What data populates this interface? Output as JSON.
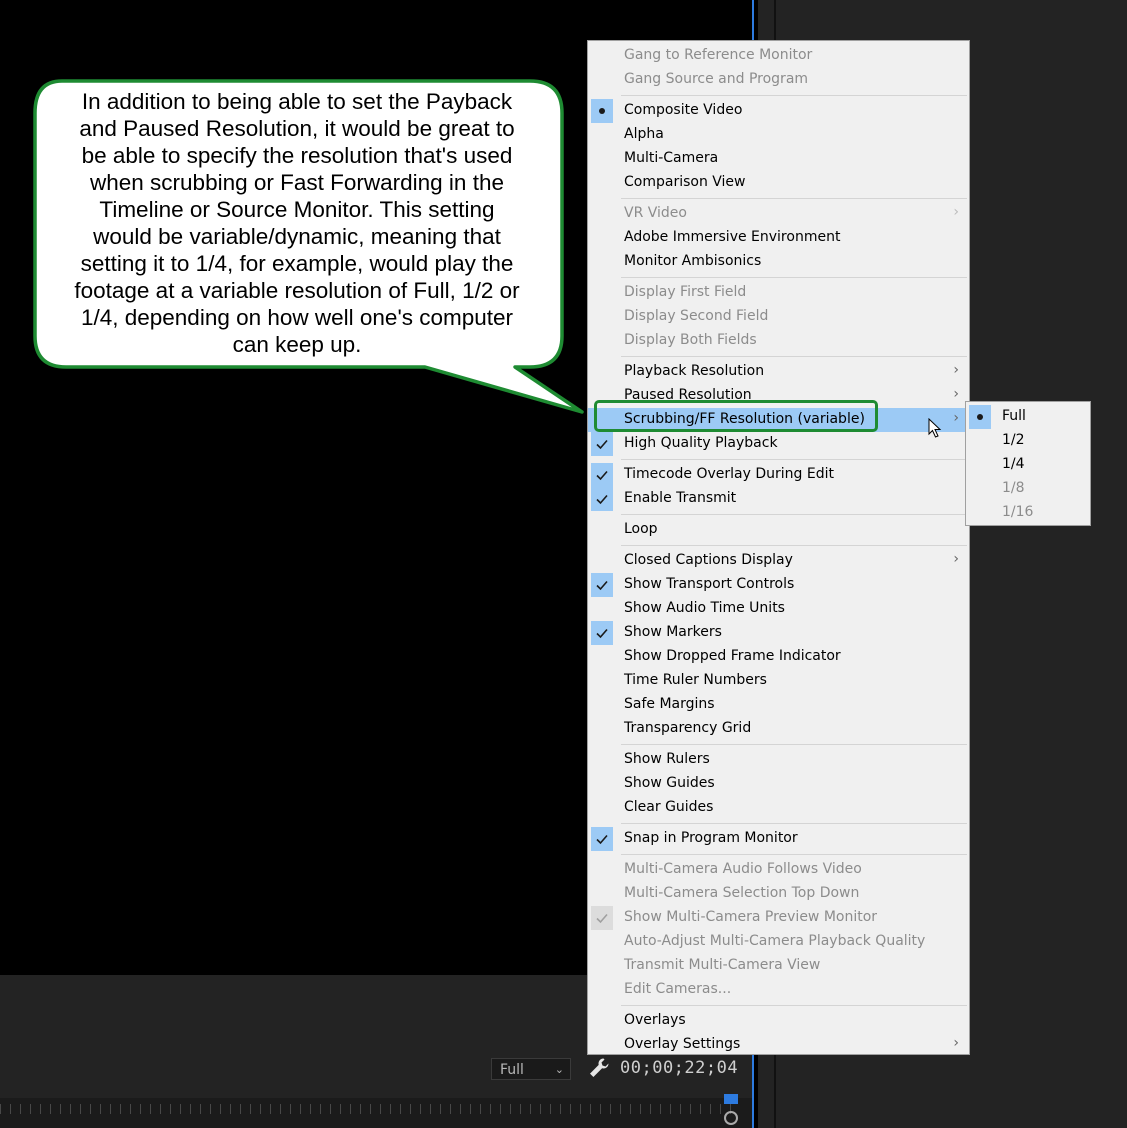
{
  "callout": {
    "lines": [
      "In addition to being able to set the Payback",
      "and Paused Resolution, it would be great to",
      "be able to specify the resolution that's used",
      "when scrubbing or Fast Forwarding in the",
      "Timeline or Source Monitor.  This setting",
      "would be variable/dynamic, meaning that",
      "setting it to 1/4, for example, would play the",
      "footage at a variable resolution of Full, 1/2 or",
      "1/4, depending on how well one's computer",
      "can keep up."
    ],
    "border_color": "#1e8b32"
  },
  "menu": {
    "groups": [
      [
        {
          "label": "Gang to Reference Monitor",
          "disabled": true
        },
        {
          "label": "Gang Source and Program",
          "disabled": true
        }
      ],
      [
        {
          "label": "Composite Video",
          "mark": "dot"
        },
        {
          "label": "Alpha"
        },
        {
          "label": "Multi-Camera"
        },
        {
          "label": "Comparison View"
        }
      ],
      [
        {
          "label": "VR Video",
          "disabled": true,
          "submenu": true
        },
        {
          "label": "Adobe Immersive Environment"
        },
        {
          "label": "Monitor Ambisonics"
        }
      ],
      [
        {
          "label": "Display First Field",
          "disabled": true
        },
        {
          "label": "Display Second Field",
          "disabled": true
        },
        {
          "label": "Display Both Fields",
          "disabled": true
        }
      ],
      [
        {
          "label": "Playback Resolution",
          "submenu": true
        },
        {
          "label": "Paused Resolution",
          "submenu": true
        },
        {
          "label": "Scrubbing/FF Resolution (variable)",
          "submenu": true,
          "highlighted": true
        },
        {
          "label": "High Quality Playback",
          "mark": "check"
        }
      ],
      [
        {
          "label": "Timecode Overlay During Edit",
          "mark": "check"
        },
        {
          "label": "Enable Transmit",
          "mark": "check"
        }
      ],
      [
        {
          "label": "Loop"
        }
      ],
      [
        {
          "label": "Closed Captions Display",
          "submenu": true
        },
        {
          "label": "Show Transport Controls",
          "mark": "check"
        },
        {
          "label": "Show Audio Time Units"
        },
        {
          "label": "Show Markers",
          "mark": "check"
        },
        {
          "label": "Show Dropped Frame Indicator"
        },
        {
          "label": "Time Ruler Numbers"
        },
        {
          "label": "Safe Margins"
        },
        {
          "label": "Transparency Grid"
        }
      ],
      [
        {
          "label": "Show Rulers"
        },
        {
          "label": "Show Guides"
        },
        {
          "label": "Clear Guides"
        }
      ],
      [
        {
          "label": "Snap in Program Monitor",
          "mark": "check"
        }
      ],
      [
        {
          "label": "Multi-Camera Audio Follows Video",
          "disabled": true
        },
        {
          "label": "Multi-Camera Selection Top Down",
          "disabled": true
        },
        {
          "label": "Show Multi-Camera Preview Monitor",
          "disabled": true,
          "mark": "check-grey"
        },
        {
          "label": "Auto-Adjust Multi-Camera Playback Quality",
          "disabled": true
        },
        {
          "label": "Transmit Multi-Camera View",
          "disabled": true
        },
        {
          "label": "Edit Cameras...",
          "disabled": true
        }
      ],
      [
        {
          "label": "Overlays"
        },
        {
          "label": "Overlay Settings",
          "submenu": true
        }
      ]
    ]
  },
  "submenu": {
    "items": [
      {
        "label": "Full",
        "mark": "dot"
      },
      {
        "label": "1/2"
      },
      {
        "label": "1/4"
      },
      {
        "label": "1/8",
        "disabled": true
      },
      {
        "label": "1/16",
        "disabled": true
      }
    ]
  },
  "transport": {
    "zoom_value": "Full",
    "timecode": "00;00;22;04"
  },
  "colors": {
    "menu_bg": "#f0f0f0",
    "highlight": "#9ccaf5",
    "accent_blue": "#2d7be0"
  }
}
